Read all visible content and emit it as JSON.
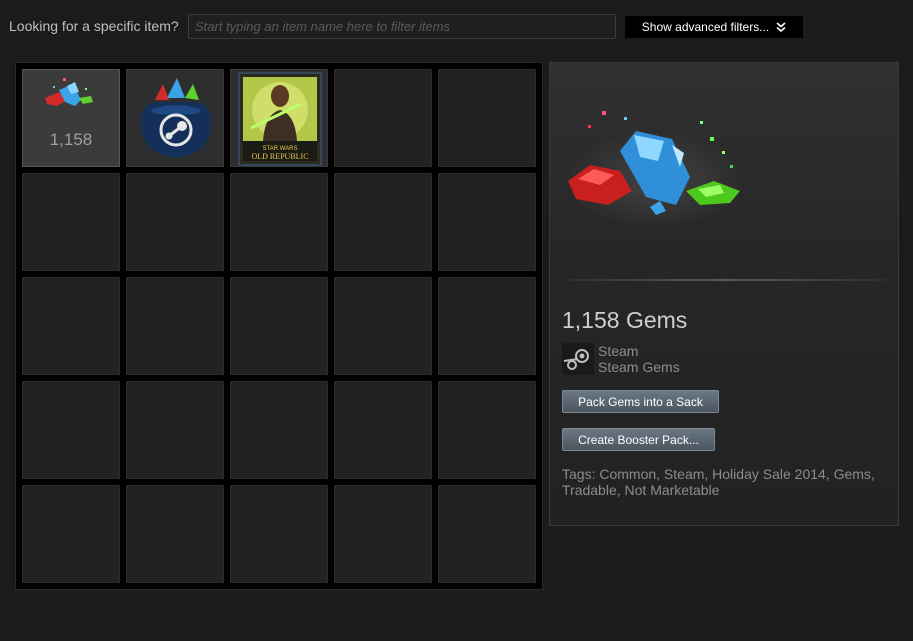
{
  "filter": {
    "label": "Looking for a specific item?",
    "placeholder": "Start typing an item name here to filter items",
    "advanced_label": "Show advanced filters...",
    "advanced_icon": "double-chevron-down-icon"
  },
  "inventory": {
    "items": [
      {
        "name": "gems",
        "count": "1,158",
        "icon": "gems-icon",
        "selected": true
      },
      {
        "name": "sack-of-gems",
        "icon": "gem-sack-icon"
      },
      {
        "name": "star-wars-old-republic-card",
        "icon": "trading-card-icon",
        "card_text": "STAR WARS OLD REPUBLIC"
      }
    ]
  },
  "detail": {
    "name": "1,158 Gems",
    "game": "Steam",
    "type": "Steam Gems",
    "game_icon": "steam-icon",
    "buttons": {
      "pack": "Pack Gems into a Sack",
      "booster": "Create Booster Pack..."
    },
    "tags": "Tags: Common, Steam, Holiday Sale 2014, Gems, Tradable, Not Marketable"
  },
  "colors": {
    "background": "#1b1b1b",
    "button": "#5b6670",
    "text_muted": "#8c8c8c"
  }
}
